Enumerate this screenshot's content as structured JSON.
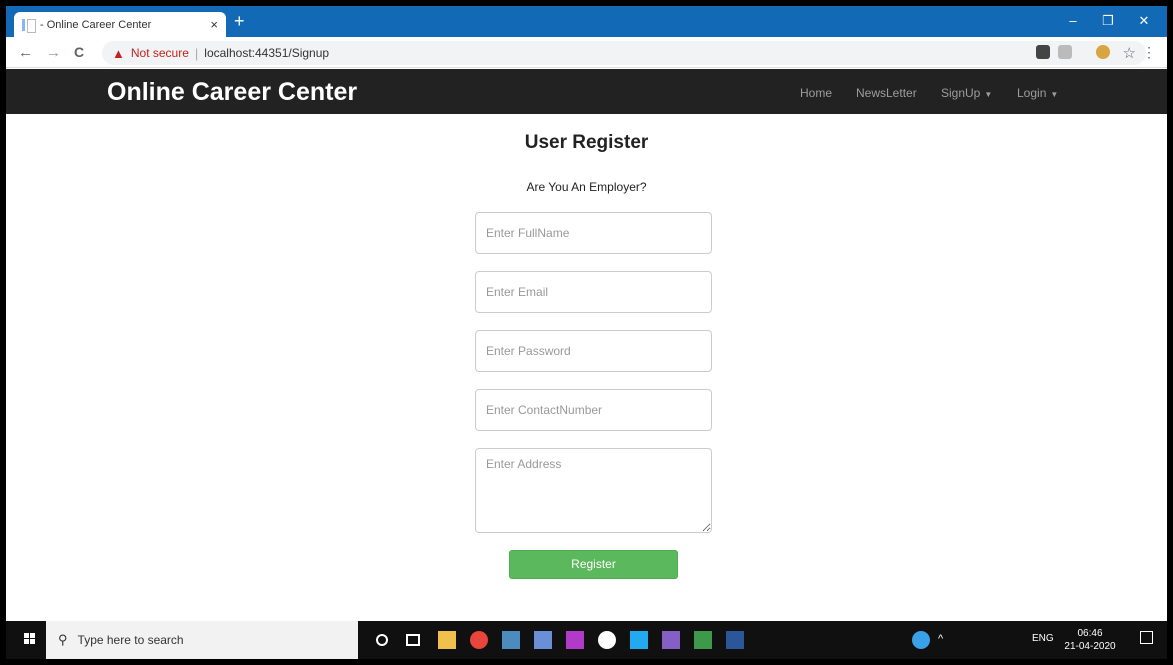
{
  "browser": {
    "tab_title": "- Online Career Center",
    "tab_close": "×",
    "new_tab": "+",
    "minimize": "–",
    "restore": "❐",
    "close": "✕",
    "back": "←",
    "forward": "→",
    "reload": "C",
    "not_secure": "Not secure",
    "separator": "|",
    "url": "localhost:44351/Signup",
    "bookmark_star": "☆",
    "menu": "⋮"
  },
  "navbar": {
    "brand": "Online Career Center",
    "links": [
      "Home",
      "NewsLetter",
      "SignUp",
      "Login"
    ]
  },
  "form": {
    "title": "User Register",
    "employer_link": "Are You An Employer?",
    "fullname_placeholder": "Enter FullName",
    "email_placeholder": "Enter Email",
    "password_placeholder": "Enter Password",
    "contact_placeholder": "Enter ContactNumber",
    "address_placeholder": "Enter Address",
    "register_label": "Register"
  },
  "taskbar": {
    "search_placeholder": "Type here to search",
    "lang": "ENG",
    "time": "06:46",
    "date": "21-04-2020"
  },
  "colors": {
    "titlebar": "#1269b5",
    "navbar": "#222222",
    "register_button": "#5cb85c",
    "taskbar": "#101010"
  }
}
